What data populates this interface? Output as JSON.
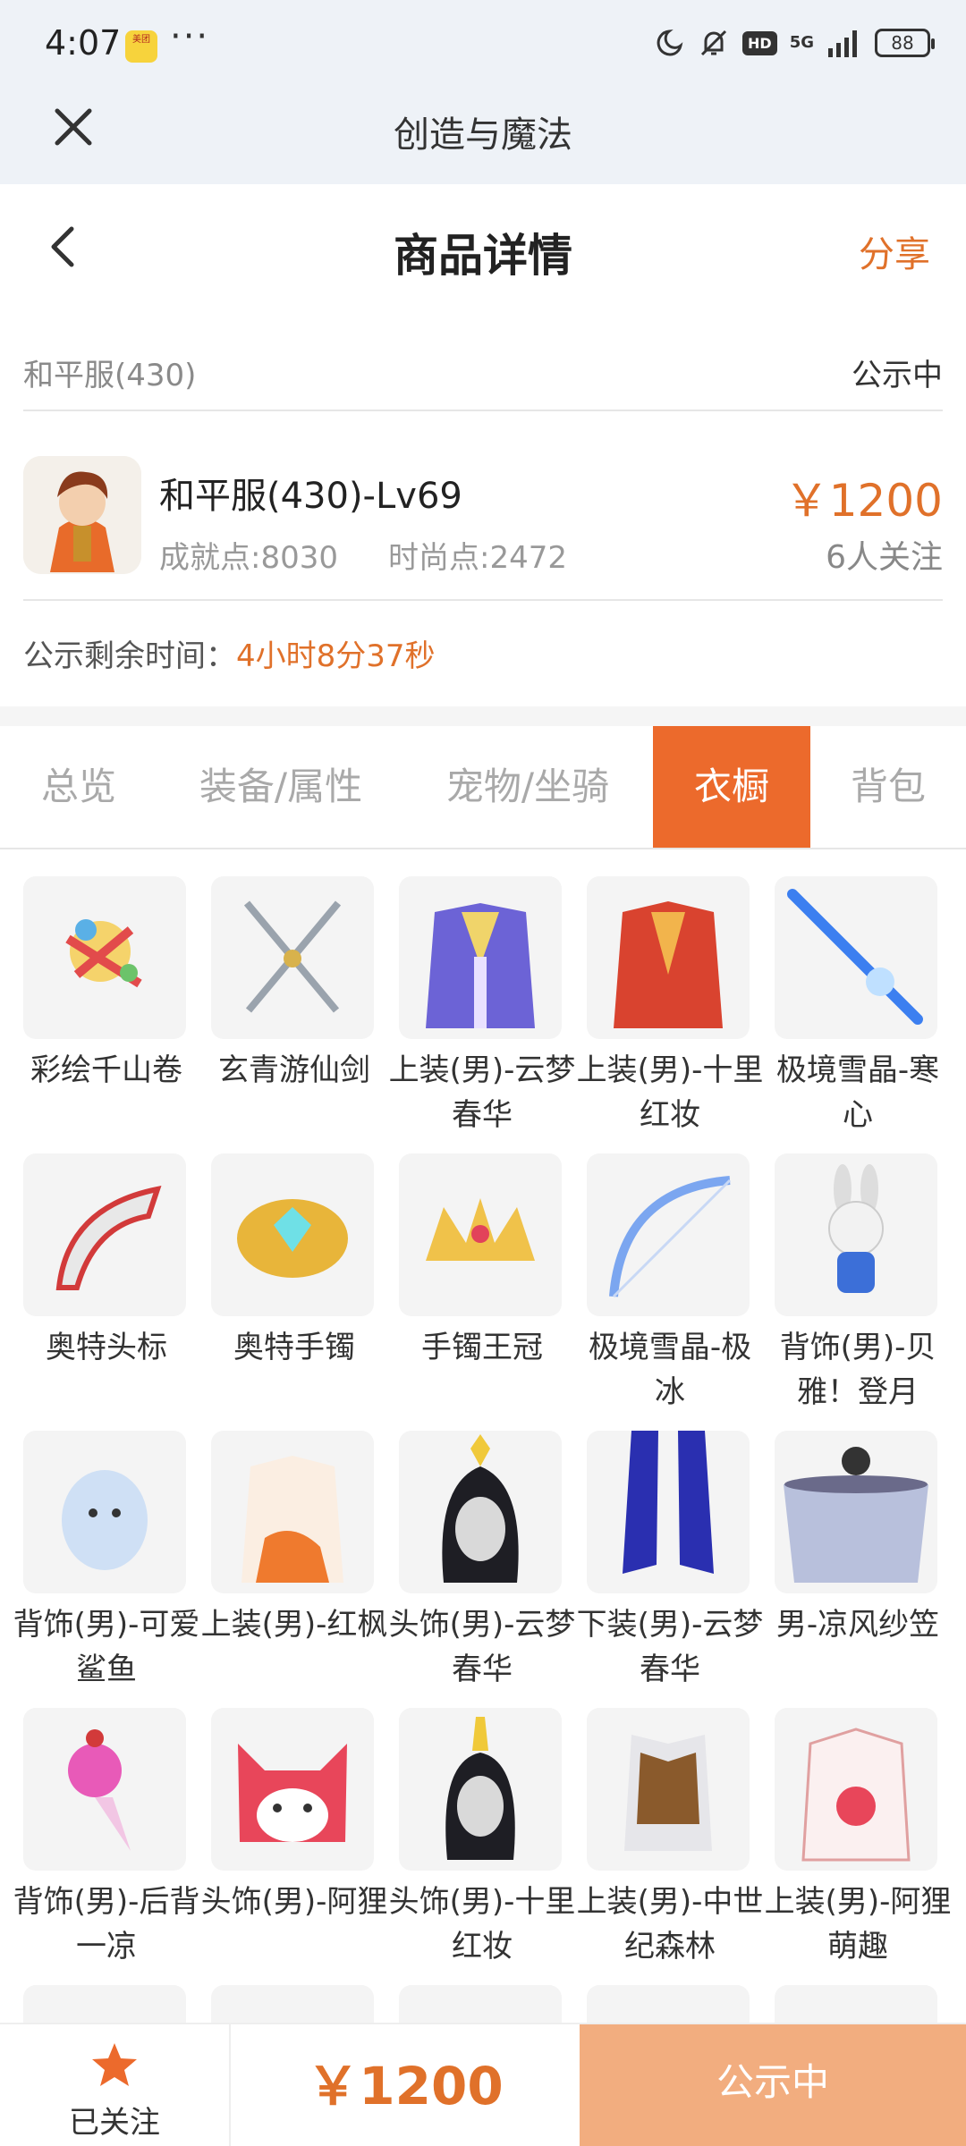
{
  "status_bar": {
    "time": "4:07",
    "app_badge": "美团",
    "more": "···",
    "network": "5G",
    "hd": "HD",
    "battery": "88"
  },
  "app_header": {
    "title": "创造与魔法"
  },
  "nav": {
    "title": "商品详情",
    "share": "分享"
  },
  "server": {
    "name": "和平服(430)",
    "status": "公示中"
  },
  "item": {
    "title": "和平服(430)-Lv69",
    "achievement": "成就点:8030",
    "fashion": "时尚点:2472",
    "price": "￥1200",
    "followers": "6人关注"
  },
  "timer": {
    "label": "公示剩余时间：",
    "value": "4小时8分37秒"
  },
  "tabs": [
    {
      "label": "总览"
    },
    {
      "label": "装备/属性"
    },
    {
      "label": "宠物/坐骑"
    },
    {
      "label": "衣橱"
    },
    {
      "label": "背包"
    }
  ],
  "active_tab": "衣橱",
  "wardrobe": [
    {
      "name": "彩绘千山卷",
      "icon": "scroll-icon"
    },
    {
      "name": "玄青游仙剑",
      "icon": "crossed-swords-icon"
    },
    {
      "name": "上装(男)-云梦春华",
      "icon": "robe-icon"
    },
    {
      "name": "上装(男)-十里红妆",
      "icon": "red-robe-icon"
    },
    {
      "name": "极境雪晶-寒心",
      "icon": "ice-sword-icon"
    },
    {
      "name": "奥特头标",
      "icon": "headband-icon"
    },
    {
      "name": "奥特手镯",
      "icon": "bracelet-icon"
    },
    {
      "name": "手镯王冠",
      "icon": "crown-icon"
    },
    {
      "name": "极境雪晶-极冰",
      "icon": "ice-bow-icon"
    },
    {
      "name": "背饰(男)-贝雅！登月",
      "icon": "bunny-icon"
    },
    {
      "name": "背饰(男)-可爱鲨鱼",
      "icon": "shark-icon"
    },
    {
      "name": "上装(男)-红枫",
      "icon": "maple-robe-icon"
    },
    {
      "name": "头饰(男)-云梦春华",
      "icon": "hair-ornament-icon"
    },
    {
      "name": "下装(男)-云梦春华",
      "icon": "boots-icon"
    },
    {
      "name": "男-凉风纱笠",
      "icon": "veil-hat-icon"
    },
    {
      "name": "背饰(男)-后背一凉",
      "icon": "ice-cream-icon"
    },
    {
      "name": "头饰(男)-阿狸",
      "icon": "fox-head-icon"
    },
    {
      "name": "头饰(男)-十里红妆",
      "icon": "hairpiece-icon"
    },
    {
      "name": "上装(男)-中世纪森林",
      "icon": "vest-icon"
    },
    {
      "name": "上装(男)-阿狸萌趣",
      "icon": "hoodie-icon"
    }
  ],
  "bottom_bar": {
    "follow_label": "已关注",
    "price": "￥1200",
    "action": "公示中"
  },
  "colors": {
    "accent": "#ec6a2c",
    "price": "#e0712a",
    "action_bg": "#f2ad7f"
  }
}
